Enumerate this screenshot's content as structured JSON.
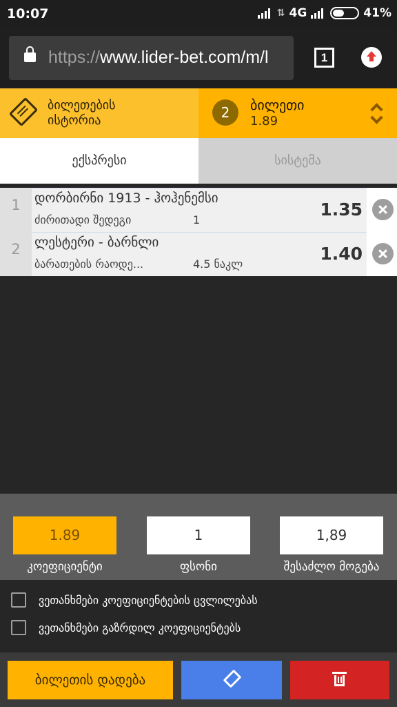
{
  "status_bar": {
    "time": "10:07",
    "network": "4G",
    "battery": "41%"
  },
  "browser": {
    "url_scheme": "https://",
    "url_rest": "www.lider-bet.com/m/l",
    "tab_count": "1"
  },
  "header": {
    "history_label_line1": "ბილეთების",
    "history_label_line2": "ისტორია",
    "ticket_count": "2",
    "ticket_label": "ბილეთი",
    "ticket_odds": "1.89"
  },
  "tabs": {
    "express": "ექსპრესი",
    "system": "სისტემა"
  },
  "bets": [
    {
      "num": "1",
      "event": "დორბირნი 1913 - ჰოჰენემსი",
      "market": "ძირითადი შედეგი",
      "pick": "1",
      "odds": "1.35"
    },
    {
      "num": "2",
      "event": "ლესტერი - ბარნლი",
      "market": "ბარათების რაოდე...",
      "pick": "4.5 ნაკლ",
      "odds": "1.40"
    }
  ],
  "stake": {
    "coefficient_value": "1.89",
    "stake_value": "1",
    "possible_win_value": "1,89",
    "coefficient_label": "კოეფიციენტი",
    "stake_label": "ფსონი",
    "possible_win_label": "შესაძლო მოგება"
  },
  "checks": {
    "accept_odds_change": "ვეთანხმები კოეფიციენტების ცვლილებას",
    "accept_increased_odds": "ვეთანხმები გაზრდილ კოეფიციენტებს"
  },
  "actions": {
    "place_bet": "ბილეთის დადება"
  },
  "colors": {
    "accent": "#ffb300",
    "accent_light": "#fcc02d",
    "blue": "#4a7ee8",
    "red": "#d32323"
  }
}
